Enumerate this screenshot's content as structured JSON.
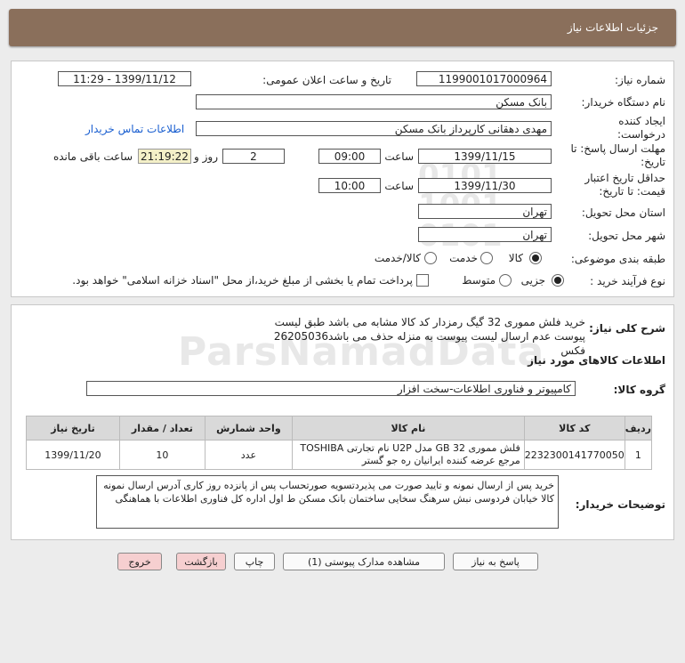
{
  "header": {
    "title": "جزئیات اطلاعات نیاز"
  },
  "form": {
    "need_number_label": "شماره نیاز:",
    "need_number": "1199001017000964",
    "announce_label": "تاریخ و ساعت اعلان عمومی:",
    "announce_value": "1399/11/12 - 11:29",
    "buyer_org_label": "نام دستگاه خریدار:",
    "buyer_org": "بانک مسکن",
    "creator_label": "ایجاد کننده درخواست:",
    "creator": "مهدی دهقانی کارپرداز بانک مسکن",
    "contact_link": "اطلاعات تماس خریدار",
    "reply_label": "مهلت ارسال پاسخ: تا تاریخ:",
    "reply_date": "1399/11/15",
    "time_label": "ساعت",
    "reply_time": "09:00",
    "days_value": "2",
    "days_label": "روز و",
    "remaining_time": "21:19:22",
    "remaining_label": "ساعت باقی مانده",
    "validity_label": "حداقل تاریخ اعتبار قیمت: تا تاریخ:",
    "validity_date": "1399/11/30",
    "validity_time": "10:00",
    "province_label": "استان محل تحویل:",
    "province": "تهران",
    "city_label": "شهر محل تحویل:",
    "city": "تهران",
    "category_label": "طبقه بندی موضوعی:",
    "category_options": [
      "کالا",
      "خدمت",
      "کالا/خدمت"
    ],
    "process_label": "نوع فرآیند خرید :",
    "process_options": [
      "جزیی",
      "متوسط"
    ],
    "payment_note": "پرداخت تمام یا بخشی از مبلغ خرید،از محل \"اسناد خزانه اسلامی\" خواهد بود."
  },
  "summary": {
    "label": "شرح کلی نیاز:",
    "text": "خرید فلش مموری 32 گیگ رمزدار  کد کالا مشابه می باشد طبق لیست پیوست عدم ارسال لیست پیوست به منزله حذف می باشد26205036 فکس"
  },
  "goods": {
    "section_title": "اطلاعات کالاهای مورد نیاز",
    "group_label": "گروه کالا:",
    "group_value": "کامپیوتر و فناوری اطلاعات-سخت افزار",
    "columns": [
      "ردیف",
      "کد کالا",
      "نام کالا",
      "واحد شمارش",
      "تعداد / مقدار",
      "تاریخ نیاز"
    ],
    "rows": [
      {
        "row": "1",
        "code": "2232300141770050",
        "name": "فلش مموری GB 32 مدل U2P نام تجارتی TOSHIBA مرجع عرضه کننده ایرانیان ره جو گستر",
        "unit": "عدد",
        "qty": "10",
        "date": "1399/11/20"
      }
    ]
  },
  "buyer_notes": {
    "label": "توضیحات خریدار:",
    "text": "خرید پس از ارسال نمونه و تایید صورت می پذیردتسویه صورتحساب پس از پانزده روز کاری آدرس ارسال نمونه کالا خیابان فردوسی نبش سرهنگ سخایی ساختمان بانک مسکن ط اول اداره کل فناوری اطلاعات با هماهنگی"
  },
  "buttons": {
    "reply": "پاسخ به نیاز",
    "attachments": "مشاهده مدارک پیوستی (1)",
    "print": "چاپ",
    "back": "بازگشت",
    "exit": "خروج"
  },
  "colors": {
    "header_bg": "#8a6f5b",
    "link": "#1a5fd0",
    "remaining_bg": "#f4f0c8",
    "pink_button": "#f6cfd0"
  }
}
